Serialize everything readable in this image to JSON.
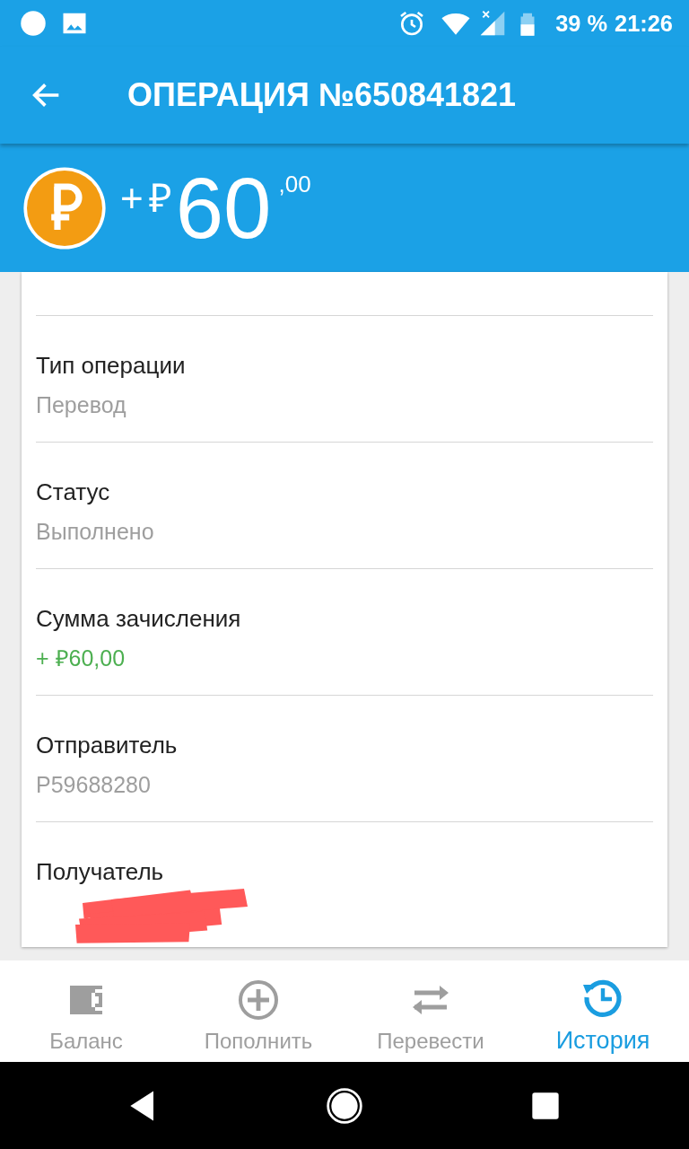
{
  "status_bar": {
    "battery": "39 %",
    "time": "21:26"
  },
  "app_bar": {
    "title": "ОПЕРАЦИЯ №650841821"
  },
  "amount": {
    "sign": "+",
    "currency": "₽",
    "whole": "60",
    "fraction": ",00"
  },
  "details": [
    {
      "label": "Тип операции",
      "value": "Перевод",
      "kind": "plain"
    },
    {
      "label": "Статус",
      "value": "Выполнено",
      "kind": "plain"
    },
    {
      "label": "Сумма зачисления",
      "value": "+ ₽60,00",
      "kind": "credit"
    },
    {
      "label": "Отправитель",
      "value": "P59688280",
      "kind": "plain"
    },
    {
      "label": "Получатель",
      "kind": "redacted"
    }
  ],
  "bottom_nav": [
    {
      "label": "Баланс",
      "kind": "wallet",
      "selected": false
    },
    {
      "label": "Пополнить",
      "kind": "add",
      "selected": false
    },
    {
      "label": "Перевести",
      "kind": "transfer",
      "selected": false
    },
    {
      "label": "История",
      "kind": "history",
      "selected": true
    }
  ]
}
